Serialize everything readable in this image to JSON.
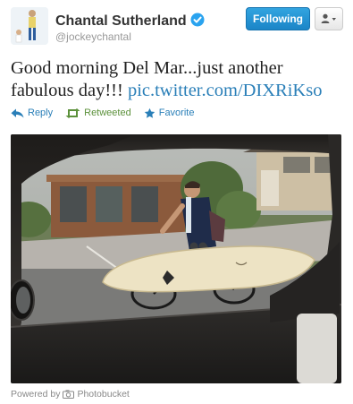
{
  "user": {
    "display_name": "Chantal Sutherland",
    "handle": "@jockeychantal",
    "verified": true,
    "verified_icon": "verified-badge-icon",
    "avatar_icon": "avatar-icon"
  },
  "buttons": {
    "follow_label": "Following",
    "menu_icon": "user-dropdown-icon"
  },
  "tweet": {
    "text": "Good morning Del Mar...just another fabulous day!!!",
    "link": "pic.twitter.com/DIXRiKso"
  },
  "actions": {
    "reply_label": "Reply",
    "retweeted_label": "Retweeted",
    "favorite_label": "Favorite"
  },
  "footer": {
    "powered_by": "Powered by",
    "provider": "Photobucket"
  },
  "colors": {
    "follow_button": "#1b85c7",
    "link": "#2a7fb8",
    "retweeted": "#5c913b"
  }
}
